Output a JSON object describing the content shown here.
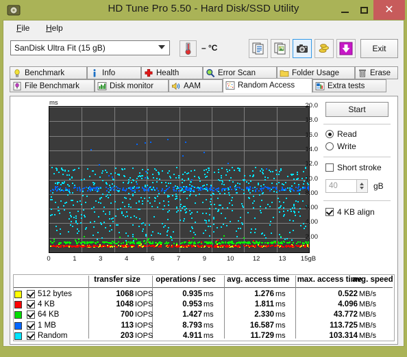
{
  "window": {
    "title": "HD Tune Pro 5.50 - Hard Disk/SSD Utility",
    "icon": "disk-icon",
    "frame_color": "#aab357",
    "minimize": "–",
    "maximize": "□",
    "close": "✕"
  },
  "menu": {
    "items": [
      {
        "label": "File",
        "accel": "F"
      },
      {
        "label": "Help",
        "accel": "H"
      }
    ]
  },
  "toolbar": {
    "drive": "SanDisk Ultra Fit (15 gB)",
    "drive_options": [
      "SanDisk Ultra Fit (15 gB)"
    ],
    "temperature": "– °C",
    "thermometer_icon": "thermometer-icon",
    "buttons": [
      {
        "name": "copy-text-button",
        "icon": "copy-text-icon",
        "active": false
      },
      {
        "name": "copy-image-button",
        "icon": "copy-image-icon",
        "active": false
      },
      {
        "name": "screenshot-button",
        "icon": "camera-icon",
        "active": true
      },
      {
        "name": "gold-button",
        "icon": "coins-icon",
        "active": false
      },
      {
        "name": "download-button",
        "icon": "download-arrow-icon",
        "active": false
      }
    ],
    "exit_label": "Exit"
  },
  "tabs": {
    "row1": [
      {
        "label": "Benchmark",
        "icon": "lightbulb-icon",
        "selected": false
      },
      {
        "label": "Info",
        "icon": "info-icon",
        "selected": false
      },
      {
        "label": "Health",
        "icon": "red-cross-icon",
        "selected": false
      },
      {
        "label": "Error Scan",
        "icon": "magnifier-icon",
        "selected": false
      },
      {
        "label": "Folder Usage",
        "icon": "folder-icon",
        "selected": false
      },
      {
        "label": "Erase",
        "icon": "trash-icon",
        "selected": false
      }
    ],
    "row2": [
      {
        "label": "File Benchmark",
        "icon": "file-bulb-icon",
        "selected": false
      },
      {
        "label": "Disk monitor",
        "icon": "bar-chart-icon",
        "selected": false
      },
      {
        "label": "AAM",
        "icon": "speaker-icon",
        "selected": false
      },
      {
        "label": "Random Access",
        "icon": "scatter-icon",
        "selected": true
      },
      {
        "label": "Extra tests",
        "icon": "chart-grid-icon",
        "selected": false
      }
    ]
  },
  "controls": {
    "start_label": "Start",
    "mode_read": "Read",
    "mode_write": "Write",
    "mode_selected": "Read",
    "short_stroke_label": "Short stroke",
    "short_stroke_checked": false,
    "short_stroke_value": "40",
    "short_stroke_unit": "gB",
    "align_label": "4 KB align",
    "align_checked": true
  },
  "chart_data": {
    "type": "scatter",
    "title": "",
    "xlabel": "",
    "ylabel": "ms",
    "yunit": "ms",
    "xunit": "gB",
    "xlim": [
      0,
      15
    ],
    "ylim": [
      0,
      20
    ],
    "grid": true,
    "background": "#3b3b3b",
    "gridcolor": "#808080",
    "ytick_labels": [
      "20.0",
      "18.0",
      "16.0",
      "14.0",
      "12.0",
      "10.0",
      "8.00",
      "6.00",
      "4.00",
      "2.00"
    ],
    "ytick_values": [
      20,
      18,
      16,
      14,
      12,
      10,
      8,
      6,
      4,
      2
    ],
    "xtick_labels": [
      "0",
      "1",
      "3",
      "4",
      "6",
      "7",
      "9",
      "10",
      "12",
      "13",
      "15gB"
    ],
    "xtick_values": [
      0,
      1.5,
      3,
      4.5,
      6,
      7.5,
      9,
      10.5,
      12,
      13.5,
      15
    ],
    "series": [
      {
        "name": "512 bytes",
        "color": "#ffff00",
        "mean_ms": 0.935,
        "max_ms": 1.276,
        "spread": 0.12,
        "count": 150
      },
      {
        "name": "4 KB",
        "color": "#ff0000",
        "mean_ms": 0.953,
        "max_ms": 1.811,
        "spread": 0.1,
        "count": 300
      },
      {
        "name": "64 KB",
        "color": "#00ff00",
        "mean_ms": 1.427,
        "max_ms": 2.33,
        "spread": 0.14,
        "count": 300
      },
      {
        "name": "1 MB",
        "color": "#0066ff",
        "mean_ms": 8.793,
        "max_ms": 16.587,
        "spread": 0.3,
        "count": 300
      },
      {
        "name": "Random",
        "color": "#00e5ff",
        "mean_ms": 4.911,
        "max_ms": 11.729,
        "spread": 2.6,
        "count": 700
      }
    ]
  },
  "table": {
    "headers": [
      "transfer size",
      "operations / sec",
      "avg. access time",
      "max. access time",
      "avg. speed"
    ],
    "rows": [
      {
        "color": "#ffff00",
        "checked": true,
        "label": "512 bytes",
        "iops": "1068",
        "iops_unit": "IOPS",
        "avg": "0.935",
        "avg_unit": "ms",
        "max": "1.276",
        "max_unit": "ms",
        "speed": "0.522",
        "speed_unit": "MB/s"
      },
      {
        "color": "#ff0000",
        "checked": true,
        "label": "4 KB",
        "iops": "1048",
        "iops_unit": "IOPS",
        "avg": "0.953",
        "avg_unit": "ms",
        "max": "1.811",
        "max_unit": "ms",
        "speed": "4.096",
        "speed_unit": "MB/s"
      },
      {
        "color": "#00dd00",
        "checked": true,
        "label": "64 KB",
        "iops": "700",
        "iops_unit": "IOPS",
        "avg": "1.427",
        "avg_unit": "ms",
        "max": "2.330",
        "max_unit": "ms",
        "speed": "43.772",
        "speed_unit": "MB/s"
      },
      {
        "color": "#0066ff",
        "checked": true,
        "label": "1 MB",
        "iops": "113",
        "iops_unit": "IOPS",
        "avg": "8.793",
        "avg_unit": "ms",
        "max": "16.587",
        "max_unit": "ms",
        "speed": "113.725",
        "speed_unit": "MB/s"
      },
      {
        "color": "#00e5ff",
        "checked": true,
        "label": "Random",
        "iops": "203",
        "iops_unit": "IOPS",
        "avg": "4.911",
        "avg_unit": "ms",
        "max": "11.729",
        "max_unit": "ms",
        "speed": "103.314",
        "speed_unit": "MB/s"
      }
    ]
  }
}
